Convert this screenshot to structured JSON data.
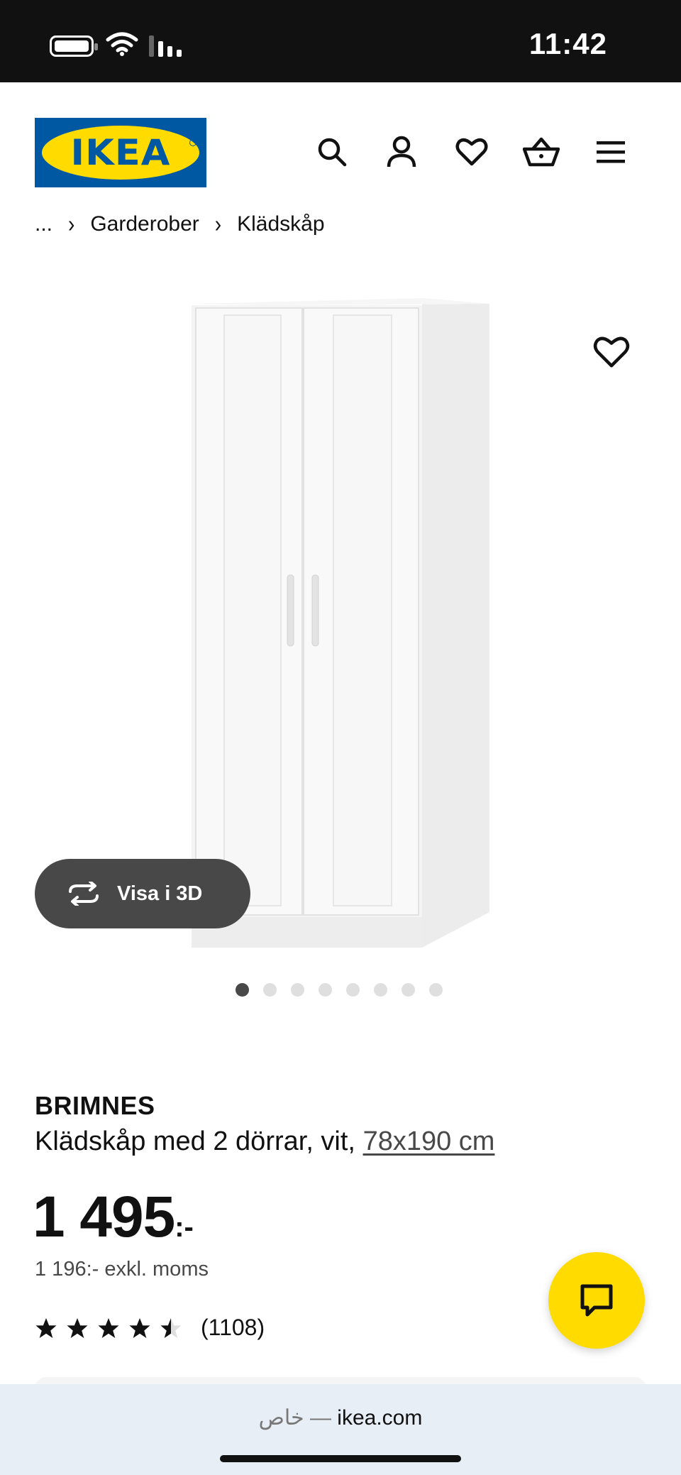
{
  "status_bar": {
    "time": "11:42",
    "icons": [
      "battery-icon",
      "wifi-icon",
      "signal-icon"
    ]
  },
  "header": {
    "logo_text": "IKEA",
    "icons": [
      "search-icon",
      "account-icon",
      "heart-icon",
      "cart-icon",
      "menu-icon"
    ]
  },
  "breadcrumb": {
    "items": [
      "...",
      "Garderober",
      "Klädskåp"
    ]
  },
  "gallery": {
    "view_3d_label": "Visa i 3D",
    "image_count": 8,
    "active_index": 0
  },
  "product": {
    "name": "BRIMNES",
    "description": "Klädskåp med 2 dörrar, vit, ",
    "size_link": "78x190 cm",
    "price_whole": "1 495",
    "price_suffix": ":-",
    "price_excl_vat": "1 196:- exkl. moms",
    "rating_value": 4.5,
    "rating_max": 5,
    "rating_count": "(1108)"
  },
  "browser": {
    "private_label": "خاص",
    "separator": " — ",
    "domain": "ikea.com"
  },
  "colors": {
    "ikea_blue": "#0058a3",
    "ikea_yellow": "#ffdb00",
    "dark_gray": "#484848"
  }
}
